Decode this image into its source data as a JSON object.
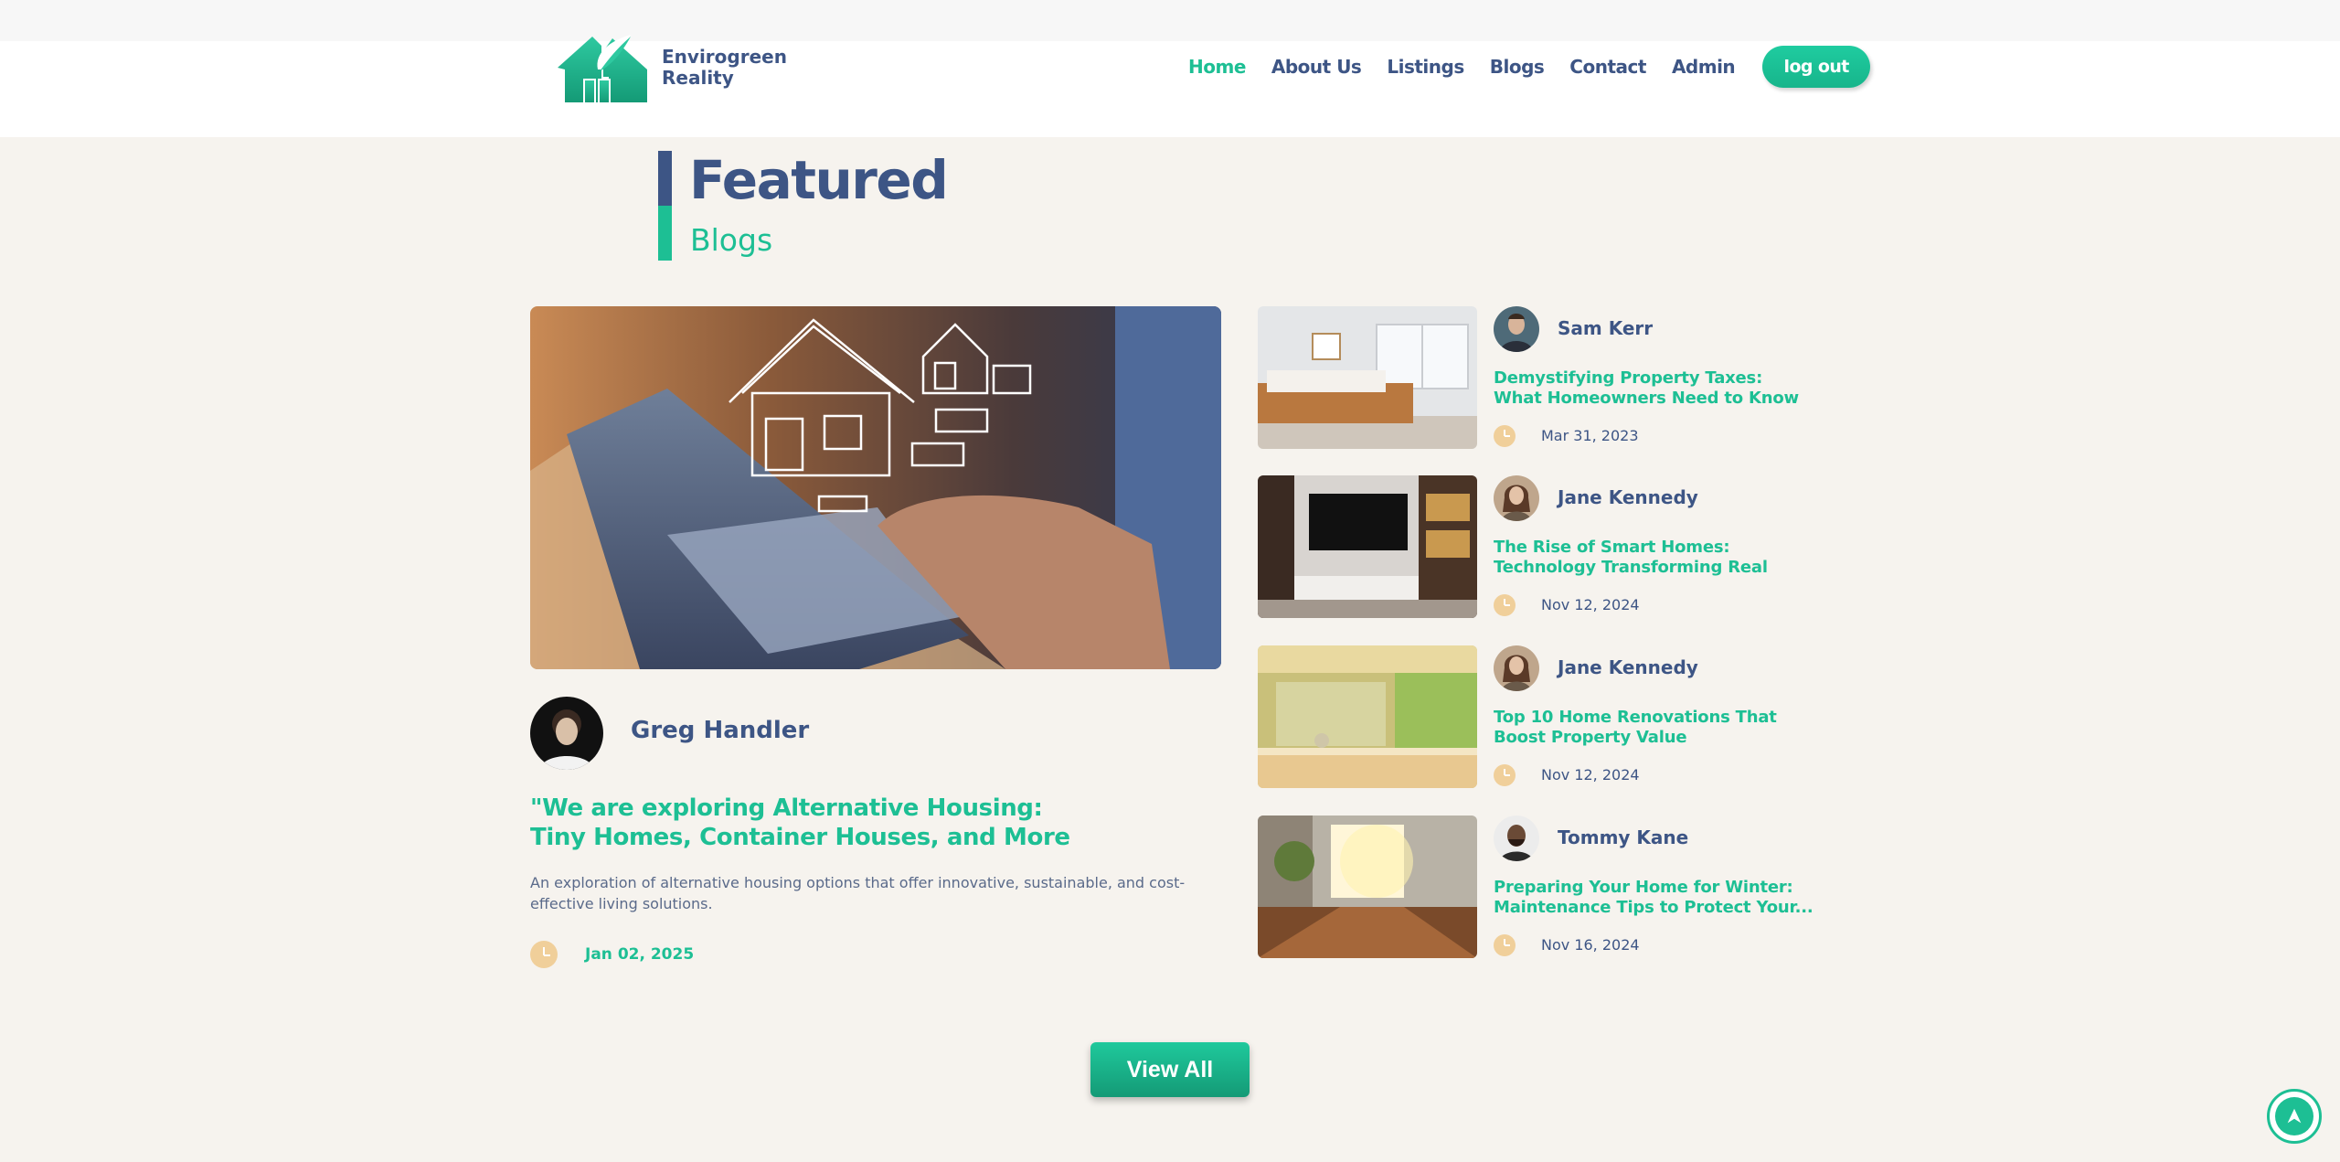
{
  "brand": {
    "line1": "Envirogreen",
    "line2": "Reality"
  },
  "nav": {
    "items": [
      {
        "label": "Home",
        "active": true
      },
      {
        "label": "About Us"
      },
      {
        "label": "Listings"
      },
      {
        "label": "Blogs"
      },
      {
        "label": "Contact"
      },
      {
        "label": "Admin"
      }
    ],
    "logout_label": "log out"
  },
  "section": {
    "title": "Featured",
    "subtitle": "Blogs"
  },
  "featured": {
    "author": "Greg Handler",
    "title": "\"We are exploring Alternative Housing: Tiny Homes, Container Houses, and More",
    "description": "An exploration of alternative housing options that offer innovative, sustainable, and cost-effective living solutions.",
    "date": "Jan 02, 2025"
  },
  "side_posts": [
    {
      "author": "Sam Kerr",
      "title": "Demystifying Property Taxes: What Homeowners Need to Know",
      "date": "Mar 31, 2023"
    },
    {
      "author": "Jane Kennedy",
      "title": "The Rise of Smart Homes: Technology Transforming Real Estate",
      "date": "Nov 12, 2024"
    },
    {
      "author": "Jane Kennedy",
      "title": "Top 10 Home Renovations That Boost Property Value",
      "date": "Nov 12, 2024"
    },
    {
      "author": "Tommy Kane",
      "title_line1": "Preparing Your Home for Winter:",
      "title_line2": "Maintenance Tips to Protect Your...",
      "date": "Nov 16, 2024"
    }
  ],
  "view_all_label": "View All",
  "colors": {
    "primary": "#3d5585",
    "accent": "#1dbf94",
    "clock": "#f0cf9a",
    "background": "#f6f3ee"
  }
}
